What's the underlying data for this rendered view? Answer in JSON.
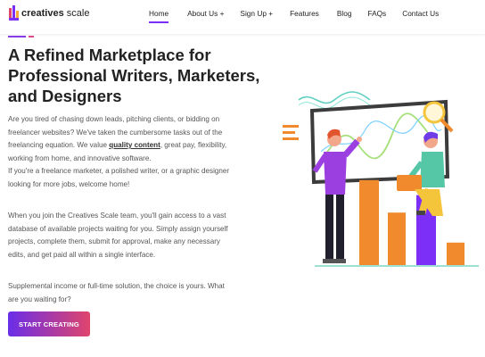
{
  "brand": {
    "name_bold": "creatives",
    "name_rest": " scale",
    "colors": [
      "#e0456c",
      "#7b2ff7",
      "#f4a93a"
    ]
  },
  "nav": {
    "items": [
      {
        "label": "Home",
        "active": true
      },
      {
        "label": "About Us +",
        "active": false
      },
      {
        "label": "Sign Up +",
        "active": false
      },
      {
        "label": "Features",
        "active": false
      },
      {
        "label": "Blog",
        "active": false
      },
      {
        "label": "FAQs",
        "active": false
      },
      {
        "label": "Contact Us",
        "active": false
      }
    ]
  },
  "hero": {
    "title": "A Refined Marketplace for Professional Writers, Marketers, and Designers",
    "p1_a": "Are you tired of chasing down leads, pitching clients, or bidding on freelancer websites? We've taken the cumbersome tasks out of the freelancing equation. We value ",
    "p1_bold": "quality content",
    "p1_b": ", great pay, flexibility, working from home, and innovative software.",
    "p1_c": "If you're a freelance marketer, a polished writer, or a graphic designer looking for more jobs, welcome home!",
    "p2": "When you join the Creatives Scale team, you'll gain access to a vast database of available projects waiting for you. Simply assign yourself projects, complete them, submit for approval, make any necessary edits, and get paid all within a single interface.",
    "p3": "Supplemental income or full-time solution, the choice is yours. What are you waiting for?",
    "cta_label": "START CREATING"
  },
  "theme": {
    "accent_purple": "#7b2ff7",
    "accent_pink": "#e0456c",
    "chart_orange": "#f08a2c",
    "chart_purple": "#7b2ff7"
  },
  "illustration": {
    "icon": "freelancers-presenting-chart-illustration",
    "bar_levels": [
      0.68,
      0.42,
      0.56,
      0.18
    ]
  }
}
